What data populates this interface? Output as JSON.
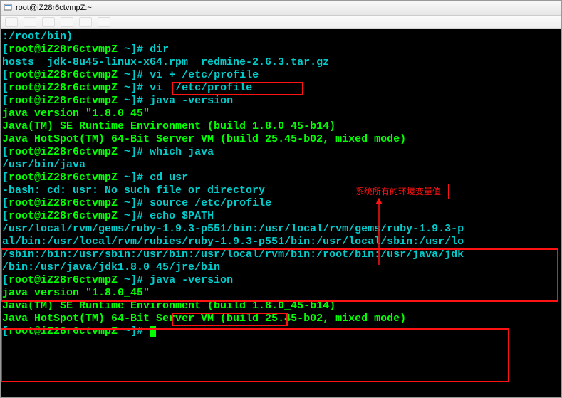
{
  "window": {
    "title": "root@iZ28r6ctvmpZ:~",
    "icon_name": "putty-icon"
  },
  "annotation": {
    "label": "系统所有的环境变量值"
  },
  "term": {
    "line0": ":/root/bin)",
    "prompt_open": "[",
    "user_host": "root@iZ28r6ctvmpZ",
    "cwd": " ~",
    "prompt_close": "]# ",
    "cmd_dir": "dir",
    "ls_out": "hosts  jdk-8u45-linux-x64.rpm  redmine-2.6.3.tar.gz",
    "cmd_vi_plus": "vi + /etc/profile",
    "cmd_vi": "vi  /etc/profile",
    "cmd_java_version": "java -version",
    "jv_line1": "java version \"1.8.0_45\"",
    "jv_line2": "Java(TM) SE Runtime Environment (build 1.8.0_45-b14)",
    "jv_line3": "Java HotSpot(TM) 64-Bit Server VM (build 25.45-b02, mixed mode)",
    "cmd_which": "which java",
    "which_out": "/usr/bin/java",
    "cmd_cd": "cd usr",
    "cd_err": "-bash: cd: usr: No such file or directory",
    "cmd_source": "source /etc/profile",
    "cmd_echo": "echo $PATH",
    "path1": "/usr/local/rvm/gems/ruby-1.9.3-p551/bin:/usr/local/rvm/gems/ruby-1.9.3-p",
    "path2": "al/bin:/usr/local/rvm/rubies/ruby-1.9.3-p551/bin:/usr/local/sbin:/usr/lo",
    "path3": "/sbin:/bin:/usr/sbin:/usr/bin:/usr/local/rvm/bin:/root/bin:/usr/java/jdk",
    "path4": "/bin:/usr/java/jdk1.8.0_45/jre/bin"
  }
}
